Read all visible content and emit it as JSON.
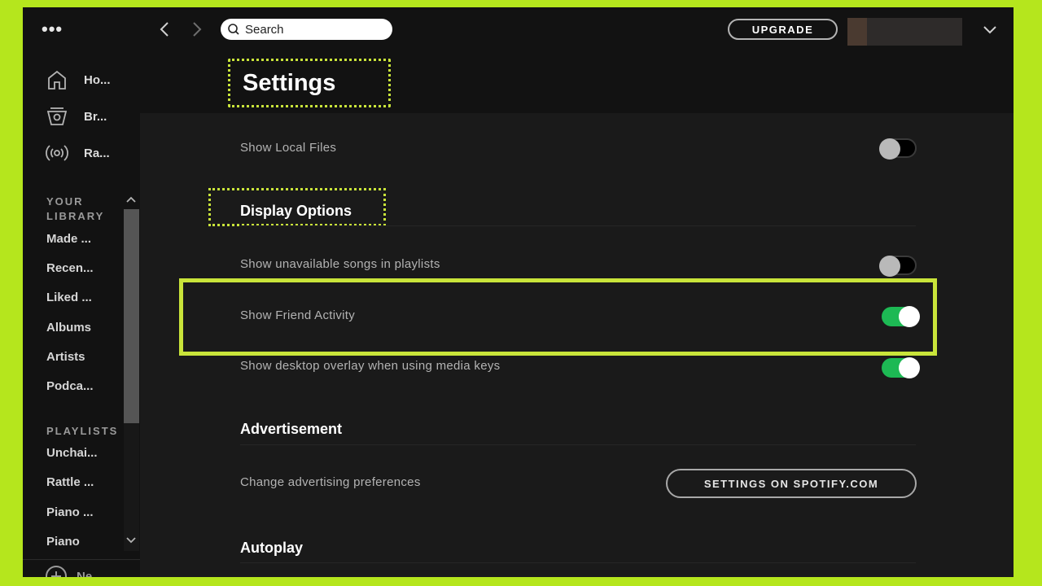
{
  "topbar": {
    "menu_icon": "more-horizontal-icon",
    "back_icon": "chevron-left-icon",
    "forward_icon": "chevron-right-icon",
    "search": {
      "placeholder": "Search",
      "value": ""
    },
    "upgrade_label": "UPGRADE",
    "profile_chevron": "chevron-down-icon"
  },
  "sidebar": {
    "nav": [
      {
        "label": "Ho...",
        "icon": "home-icon"
      },
      {
        "label": "Br...",
        "icon": "browse-icon"
      },
      {
        "label": "Ra...",
        "icon": "radio-icon"
      }
    ],
    "library_title_1": "YOUR",
    "library_title_2": "LIBRARY",
    "library": [
      "Made ...",
      "Recen...",
      "Liked ...",
      "Albums",
      "Artists",
      "Podca..."
    ],
    "playlists_title": "PLAYLISTS",
    "playlists": [
      "Unchai...",
      "Rattle ...",
      "Piano ...",
      "Piano"
    ],
    "new_playlist_label": "Ne..."
  },
  "main": {
    "page_title": "Settings",
    "rows": {
      "local_files": {
        "label": "Show Local Files",
        "on": false
      },
      "display_options": "Display Options",
      "unavailable_songs": {
        "label": "Show unavailable songs in playlists",
        "on": false
      },
      "friend_activity": {
        "label": "Show Friend Activity",
        "on": true
      },
      "desktop_overlay": {
        "label": "Show desktop overlay when using media keys",
        "on": true
      },
      "advertisement": "Advertisement",
      "ad_prefs": {
        "label": "Change advertising preferences",
        "button": "SETTINGS ON SPOTIFY.COM"
      },
      "autoplay": "Autoplay"
    }
  },
  "colors": {
    "highlight": "#c9e43a",
    "toggle_on": "#1db954",
    "frame_bg": "#b5e61d"
  }
}
